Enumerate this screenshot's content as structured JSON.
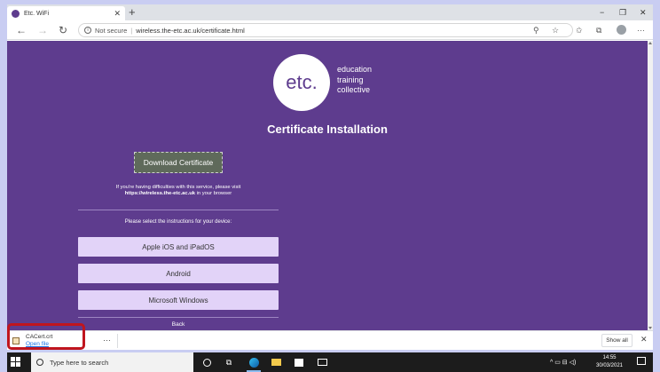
{
  "browser": {
    "tab_title": "Etc. WiFi",
    "tab_close": "✕",
    "new_tab": "+",
    "window_controls": {
      "minimize": "−",
      "restore": "❐",
      "close": "✕"
    },
    "nav": {
      "back": "←",
      "forward": "→",
      "reload": "↻"
    },
    "address": {
      "security_label": "Not secure",
      "url": "wireless.the-etc.ac.uk/certificate.html"
    },
    "tools": {
      "zoom": "⚲",
      "favorite": "☆",
      "favorites": "✩",
      "collections": "⧉",
      "more": "···"
    }
  },
  "page": {
    "logo_mark": "etc.",
    "logo_lines": [
      "education",
      "training",
      "collective"
    ],
    "title": "Certificate Installation",
    "download_button": "Download Certificate",
    "help_line1": "If you're having difficulties with this service, please visit",
    "help_url": "https://wireless.the-etc.ac.uk",
    "help_line2": " in your browser",
    "select_label": "Please select the instructions for your device:",
    "devices": [
      "Apple iOS and iPadOS",
      "Android",
      "Microsoft Windows"
    ],
    "back_link": "Back",
    "colors": {
      "background": "#5e3c8e",
      "device_button": "#e2d3f8",
      "download_button": "#5f6a5b"
    }
  },
  "download_shelf": {
    "file_name": "CACert.crt",
    "open_link": "Open file",
    "more": "···",
    "show_all": "Show all",
    "close": "✕"
  },
  "taskbar": {
    "search_placeholder": "Type here to search",
    "time": "14:55",
    "date": "30/03/2021",
    "tray_icons": "^ ▭ ⊟ ◁)"
  }
}
